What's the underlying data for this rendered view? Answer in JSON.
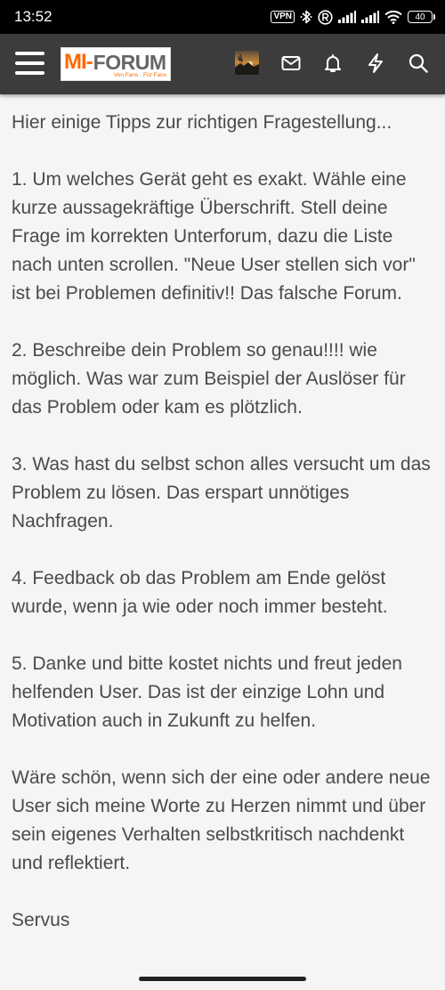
{
  "status_bar": {
    "time": "13:52",
    "vpn_label": "VPN",
    "battery_level": "40",
    "icons": [
      "vpn-icon",
      "bluetooth-icon",
      "registered-icon",
      "signal-icon",
      "signal-icon",
      "wifi-icon",
      "battery-icon"
    ]
  },
  "header": {
    "logo": {
      "mi": "MI",
      "dash": "-",
      "forum": "FORUM",
      "tagline": "Von Fans · Für Fans"
    },
    "icons": [
      "menu-icon",
      "avatar",
      "mail-icon",
      "bell-icon",
      "bolt-icon",
      "search-icon"
    ],
    "colors": {
      "background": "#3c3c3c",
      "brand": "#ff6700"
    }
  },
  "post": {
    "paragraphs": [
      "Hier einige Tipps zur richtigen Fragestellung...",
      "1. Um welches Gerät geht es exakt. Wähle eine kurze aussagekräftige Überschrift. Stell deine Frage im korrekten Unterforum, dazu die Liste nach unten scrollen. \"Neue User stellen sich vor\" ist bei Problemen definitiv!! Das falsche Forum.",
      "2. Beschreibe dein Problem so genau!!!! wie möglich. Was war zum Beispiel der Auslöser für das Problem oder kam es plötzlich.",
      "3. Was hast du selbst schon alles versucht um das Problem zu lösen. Das erspart unnötiges Nachfragen.",
      "4. Feedback ob das Problem am Ende gelöst wurde, wenn ja wie oder noch immer besteht.",
      "5. Danke und bitte kostet nichts und freut jeden helfenden User. Das ist der einzige Lohn und Motivation auch in Zukunft zu helfen.",
      "Wäre schön, wenn sich der eine oder andere neue User sich meine Worte zu Herzen nimmt und über sein eigenes Verhalten selbstkritisch nachdenkt und reflektiert.",
      "Servus"
    ]
  }
}
